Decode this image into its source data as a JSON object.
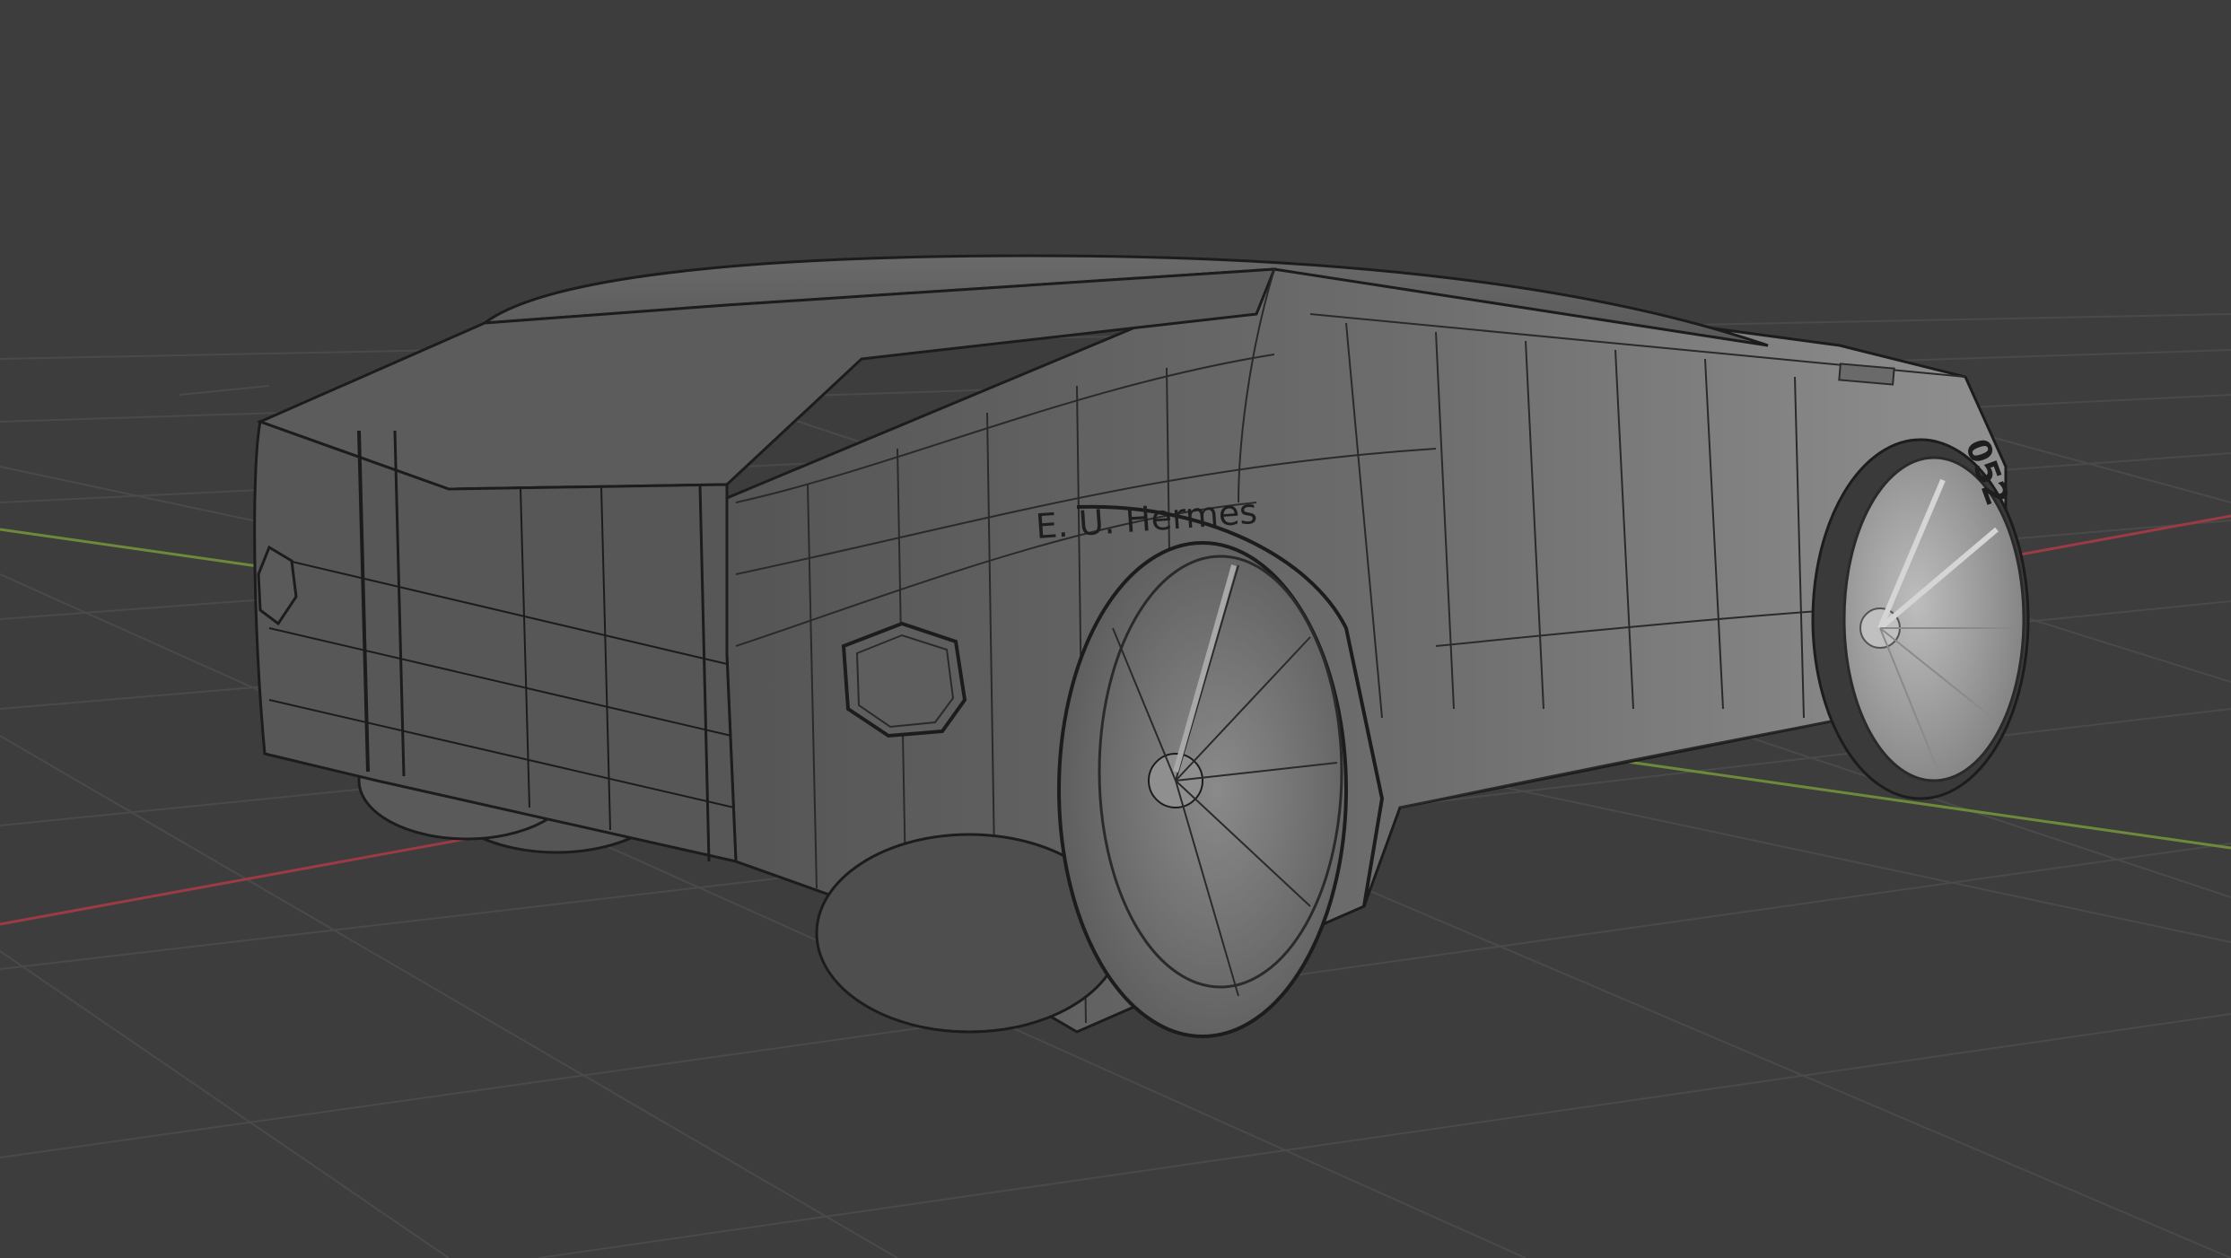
{
  "app": {
    "view": "3D Viewport",
    "shading": "Solid"
  },
  "object": {
    "name_label": "E. U. Hermes",
    "number_label": "052"
  },
  "colors": {
    "background": "#3d3d3d",
    "grid": "#4a4a4a",
    "axis_x": "#9c3b44",
    "axis_y": "#6d8a3a",
    "body": "#6b6b6b",
    "body_light": "#8a8a8a",
    "wire": "#1c1c1c"
  },
  "icons": {
    "axis_x": "x-axis-line",
    "axis_y": "y-axis-line"
  }
}
